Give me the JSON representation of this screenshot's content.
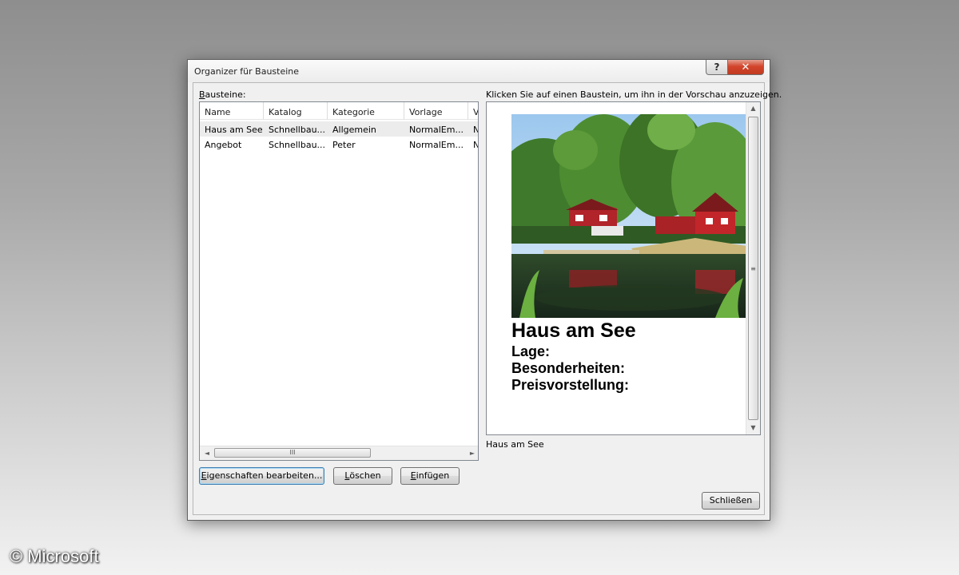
{
  "window": {
    "title": "Organizer für Bausteine",
    "help_glyph": "?",
    "close_glyph": "✕"
  },
  "left_panel": {
    "label": "Bausteine:",
    "columns": [
      "Name",
      "Katalog",
      "Kategorie",
      "Vorlage",
      "V"
    ],
    "rows": [
      {
        "name": "Haus am See",
        "katalog": "Schnellbau...",
        "kategorie": "Allgemein",
        "vorlage": "NormalEm...",
        "extra": "N"
      },
      {
        "name": "Angebot",
        "katalog": "Schnellbau...",
        "kategorie": "Peter",
        "vorlage": "NormalEm...",
        "extra": "N"
      }
    ],
    "scroll_left": "◄",
    "scroll_right": "►",
    "scroll_grip": "III"
  },
  "buttons": {
    "edit_properties": "Eigenschaften bearbeiten...",
    "delete": "Löschen",
    "insert": "Einfügen",
    "close": "Schließen"
  },
  "preview": {
    "hint": "Klicken Sie auf einen Baustein, um ihn in der Vorschau anzuzeigen.",
    "heading": "Haus am See",
    "lines": [
      "Lage:",
      "Besonderheiten:",
      "Preisvorstellung:"
    ],
    "caption": "Haus am See",
    "scroll_up": "▲",
    "scroll_down": "▼",
    "scroll_grip": "≡"
  },
  "watermark": "© Microsoft",
  "colors": {
    "selection": "#ececec",
    "close_button": "#c8442b",
    "default_button_border": "#3c7fb1"
  },
  "icons": [
    "help-icon",
    "close-icon",
    "house-lake-photo"
  ]
}
